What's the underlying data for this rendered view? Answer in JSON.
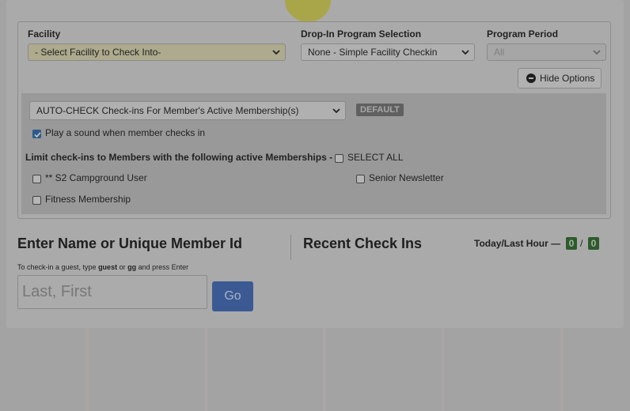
{
  "facility": {
    "label": "Facility",
    "selected": "- Select Facility to Check Into-"
  },
  "dropin": {
    "label": "Drop-In Program Selection",
    "selected": "None - Simple Facility Checkin"
  },
  "period": {
    "label": "Program Period",
    "selected": "All"
  },
  "hide_options": {
    "label": "Hide Options"
  },
  "autocheck": {
    "selected": "AUTO-CHECK Check-ins For Member's Active Membership(s)",
    "badge": "DEFAULT"
  },
  "play_sound": {
    "label": "Play a sound when member checks in",
    "checked": true
  },
  "limit": {
    "text": "Limit check-ins to Members with the following active Memberships -",
    "select_all": "SELECT ALL",
    "memberships": [
      {
        "label": "** S2 Campground User",
        "checked": false
      },
      {
        "label": "Senior Newsletter",
        "checked": false
      },
      {
        "label": "Fitness Membership",
        "checked": false
      }
    ]
  },
  "checkin": {
    "title": "Enter Name or Unique Member Id",
    "hint_prefix": "To check-in a guest, type ",
    "hint_word1": "guest",
    "hint_or": " or ",
    "hint_word2": "gg",
    "hint_suffix": " and press Enter",
    "placeholder": "Last, First",
    "go_label": "Go"
  },
  "recent": {
    "title": "Recent Check Ins",
    "stats_label": "Today/Last Hour —",
    "today_count": "0",
    "separator": "/",
    "last_hour_count": "0"
  },
  "colors": {
    "accent": "#3b5a93",
    "count_badge": "#2e5a2e",
    "default_badge": "#606060"
  }
}
